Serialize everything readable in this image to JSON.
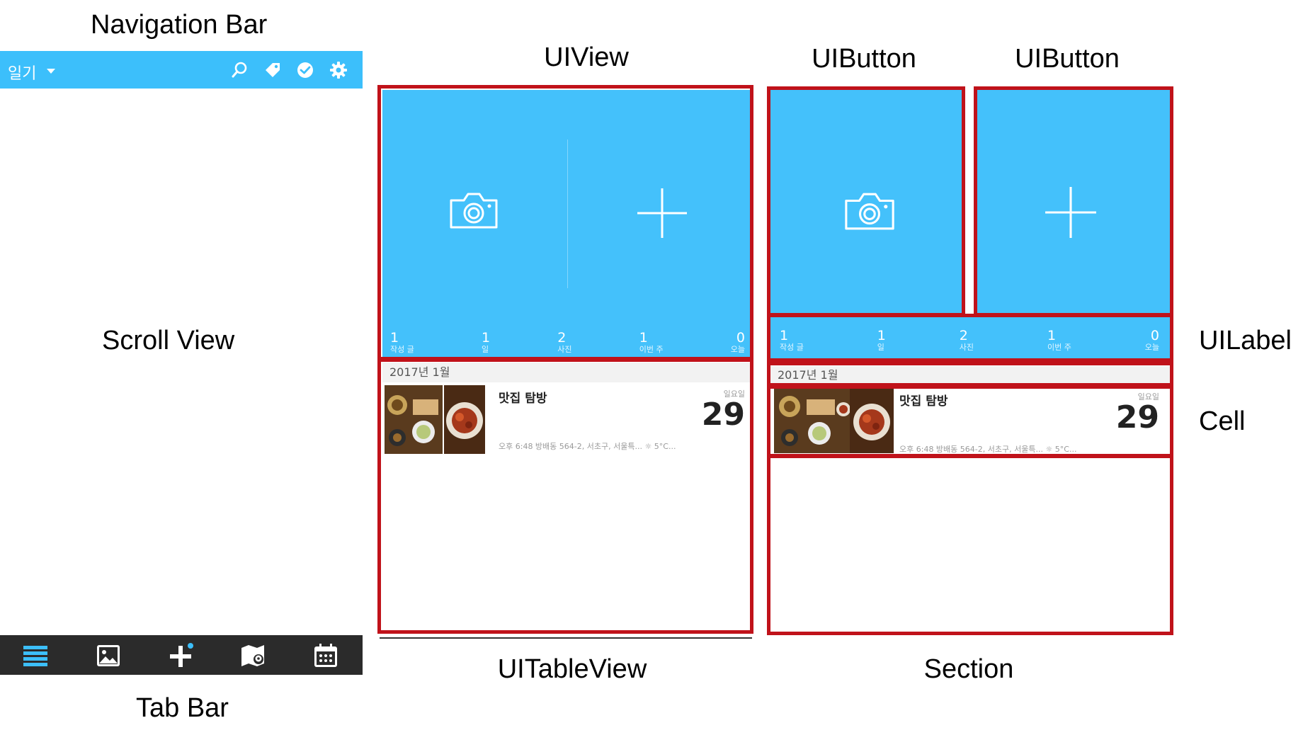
{
  "captions": {
    "navigation_bar": "Navigation Bar",
    "scroll_view": "Scroll View",
    "tab_bar": "Tab Bar",
    "uiview": "UIView",
    "uitableview": "UITableView",
    "uibutton_1": "UIButton",
    "uibutton_2": "UIButton",
    "section": "Section",
    "uilabel": "UILabel",
    "cell": "Cell"
  },
  "navbar": {
    "title": "일기",
    "icons": [
      "search-icon",
      "tag-icon",
      "check-circle-icon",
      "gear-icon"
    ]
  },
  "tabbar": {
    "icons": [
      "list-icon",
      "photo-icon",
      "add-icon",
      "map-icon",
      "calendar-icon"
    ]
  },
  "stats": [
    {
      "value": "1",
      "label": "작성 글"
    },
    {
      "value": "1",
      "label": "일"
    },
    {
      "value": "2",
      "label": "사진"
    },
    {
      "value": "1",
      "label": "이번 주"
    },
    {
      "value": "0",
      "label": "오늘"
    }
  ],
  "month_header": "2017년 1월",
  "entry": {
    "title": "맛집 탐방",
    "weekday": "일요일",
    "day": "29",
    "meta": "오후 6:48 방배동 564-2, 서초구, 서울특... ☼ 5°C..."
  },
  "colors": {
    "accent_blue": "#44c1fb",
    "highlight_red": "#c0121a",
    "tabbar_dark": "#2b2b2b"
  }
}
